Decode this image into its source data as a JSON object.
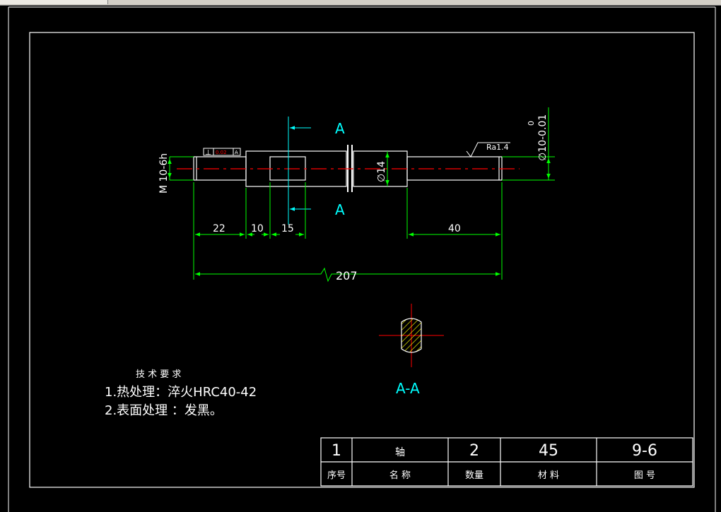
{
  "colors": {
    "background": "#000000",
    "frame": "#ffffff",
    "dimension": "#00ff00",
    "centerline": "#ff0000",
    "annotation": "#00ffff",
    "cutting_arrow": "#00ffff",
    "hatch": "#ffff00"
  },
  "drawing": {
    "section_label_top": "A",
    "section_label_bottom": "A",
    "section_view_label": "A-A",
    "thread_callout": "M 10-6h",
    "tolerance_box": {
      "symbol": "⊥",
      "value": "0.02",
      "datum": "A"
    },
    "diameter_14": "∅14",
    "roughness": "Ra1.4",
    "diameter_10": "∅10-0.01",
    "tolerance_upper": "0",
    "dimensions": {
      "d1": "22",
      "d2": "10",
      "d3": "15",
      "d4": "40",
      "total": "207"
    }
  },
  "technical_requirements": {
    "title": "技 术 要 求",
    "items": [
      "1.热处理：淬火HRC40-42",
      "2.表面处理 ：发黑。"
    ]
  },
  "title_block": {
    "row1": [
      "1",
      "轴",
      "2",
      "45",
      "9-6"
    ],
    "row2": [
      "序号",
      "名 称",
      "数量",
      "材 料",
      "图 号"
    ]
  }
}
